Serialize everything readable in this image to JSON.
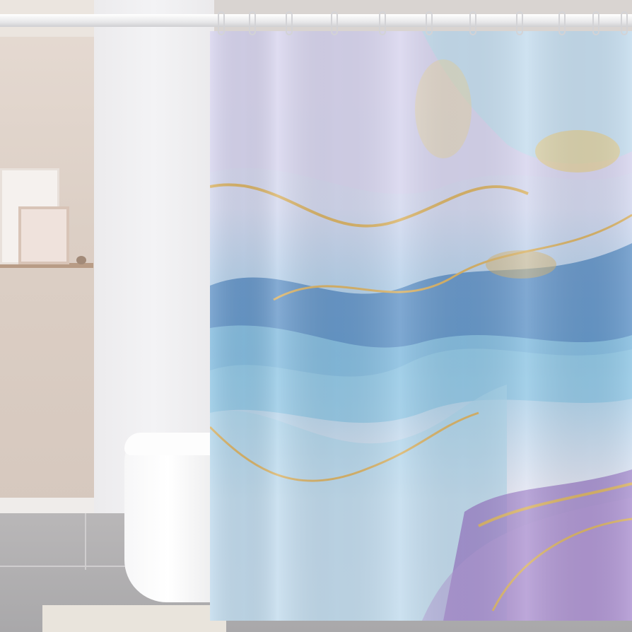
{
  "scene": {
    "subject": "shower-curtain",
    "palette": {
      "lavender": "#c9b9e4",
      "sky_blue": "#8fc3e2",
      "deep_blue": "#5a86bc",
      "gold": "#d9b46a",
      "purple": "#9a7cc6",
      "white": "#f3f1f6"
    },
    "icons": [
      "curtain-ring-icon"
    ]
  }
}
